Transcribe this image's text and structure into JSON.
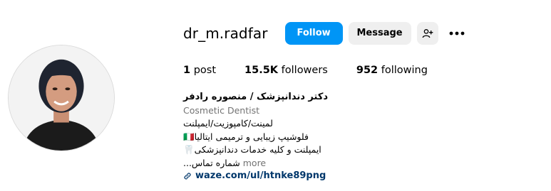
{
  "profile": {
    "username": "dr_m.radfar",
    "follow_label": "Follow",
    "message_label": "Message",
    "stats": {
      "posts_count": "1",
      "posts_label": "post",
      "followers_count": "15.5K",
      "followers_label": "followers",
      "following_count": "952",
      "following_label": "following"
    },
    "bio": {
      "display_name": "دکتر دندانپزشک / منصوره رادفر",
      "category": "Cosmetic Dentist",
      "line1": "لمینت/کامپوزیت/ایمپلنت",
      "line2": "فلوشیپ زیبایی و ترمیمی ایتالیا🇮🇹",
      "line3": "ایمپلنت و کلیه خدمات دندانپزشکی🦷",
      "line4": "شماره تماس...",
      "more_label": " more",
      "link": "waze.com/ul/htnke89png"
    }
  },
  "icons": {
    "similar_accounts": "person-add-icon",
    "more_options": "three-dots-icon",
    "link": "chain-link-icon"
  },
  "colors": {
    "follow_button": "#0095f6",
    "secondary_button": "#efefef",
    "link": "#00376b",
    "muted_text": "#737373"
  }
}
